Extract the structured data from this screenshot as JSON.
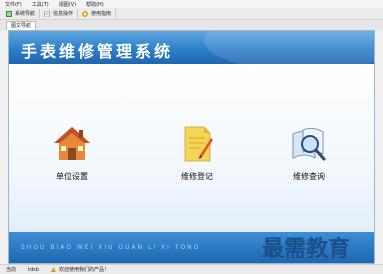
{
  "menubar": {
    "items": [
      "文件(F)",
      "工具(T)",
      "视图(V)",
      "帮助(H)"
    ]
  },
  "toolbar": {
    "buttons": [
      "系统导航",
      "信息操作",
      "使用指南"
    ]
  },
  "tab": {
    "label": "图文导航"
  },
  "banner": {
    "title": "手表维修管理系统",
    "subtitle": "SHOU BIAO WEI XIU GUAN LI XI TONG"
  },
  "tiles": [
    {
      "label": "单位设置",
      "icon": "house-icon"
    },
    {
      "label": "维修登记",
      "icon": "note-pencil-icon"
    },
    {
      "label": "维修查询",
      "icon": "search-magnifier-icon"
    }
  ],
  "statusbar": {
    "user_label": "当前",
    "user_value": "tdsb",
    "notice": "欢迎使用我们的产品！"
  },
  "watermark": "最需教育",
  "colors": {
    "banner": "#2d7fc9",
    "accent": "#1f66b0"
  }
}
